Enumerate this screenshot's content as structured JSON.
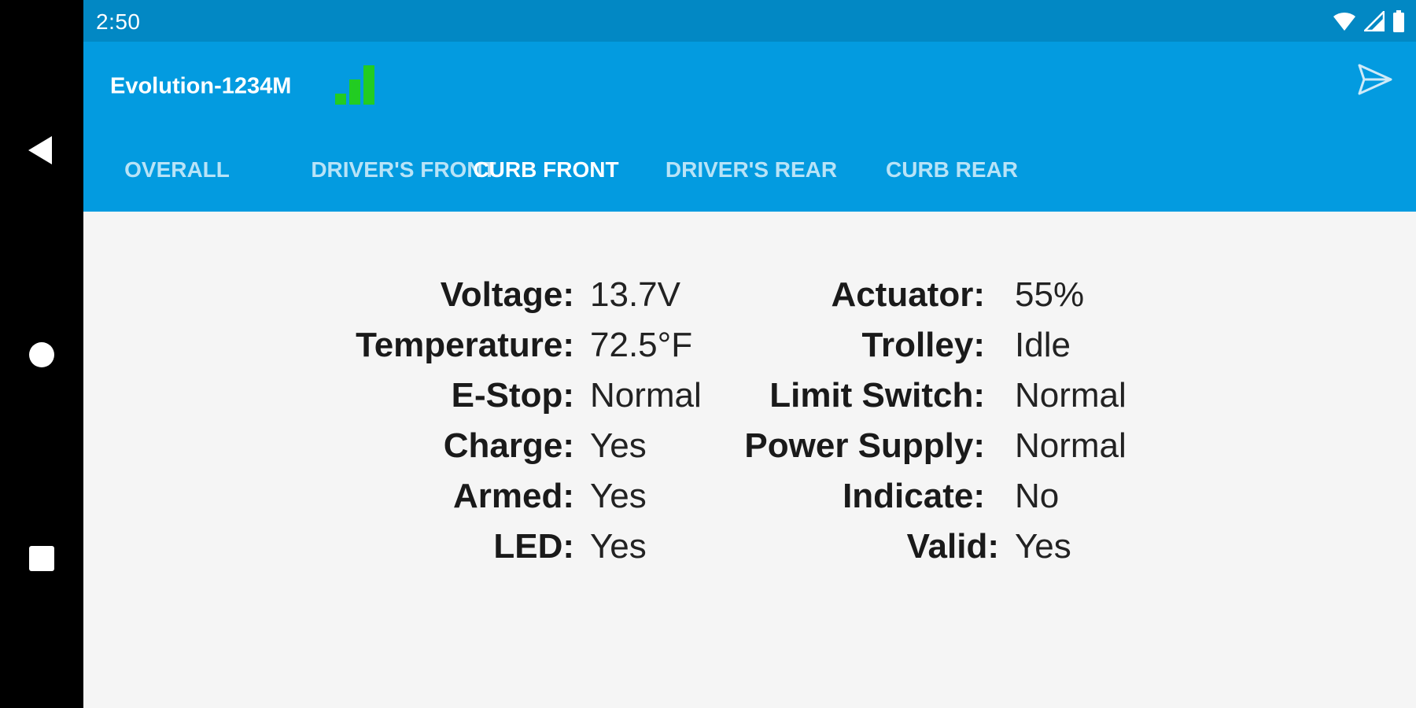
{
  "status": {
    "time": "2:50",
    "icons": [
      "wifi-icon",
      "cell-signal-icon",
      "battery-icon"
    ]
  },
  "app": {
    "title": "Evolution-1234M",
    "signal_icon": "signal-strength-icon",
    "accent": "#039be0",
    "signal_color": "#22cc22"
  },
  "tabs": [
    {
      "label": "OVERALL",
      "active": false
    },
    {
      "label": "DRIVER'S FRONT",
      "active": false
    },
    {
      "label": "CURB FRONT",
      "active": true
    },
    {
      "label": "DRIVER'S REAR",
      "active": false
    },
    {
      "label": "CURB REAR",
      "active": false
    }
  ],
  "left_fields": [
    {
      "label": "Voltage:",
      "value": "13.7V"
    },
    {
      "label": "Temperature:",
      "value": "72.5°F"
    },
    {
      "label": "E-Stop:",
      "value": "Normal"
    },
    {
      "label": "Charge:",
      "value": "Yes"
    },
    {
      "label": "Armed:",
      "value": "Yes"
    },
    {
      "label": "LED:",
      "value": "Yes"
    }
  ],
  "right_fields": [
    {
      "label": "Actuator:",
      "value": "55%"
    },
    {
      "label": "Trolley:",
      "value": "Idle"
    },
    {
      "label": "Limit Switch:",
      "value": "Normal"
    },
    {
      "label": "Power Supply:",
      "value": "Normal"
    },
    {
      "label": "Indicate:",
      "value": "No"
    },
    {
      "label": "Valid:",
      "value": "Yes"
    }
  ]
}
